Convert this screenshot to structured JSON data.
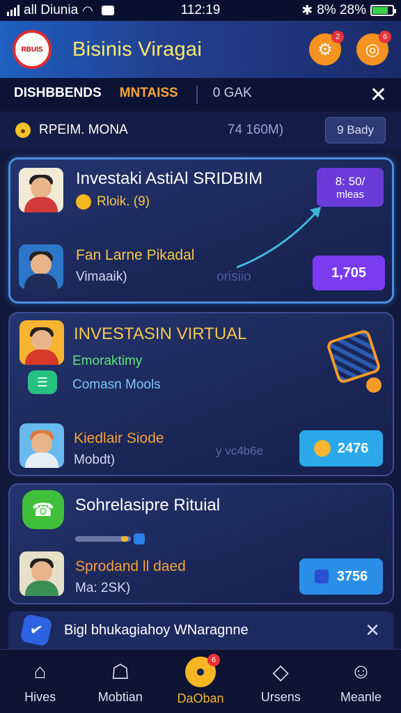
{
  "status_bar": {
    "carrier": "all Diunia",
    "time": "112:19",
    "battery_text": "8% 28%",
    "battery_level": 0.8
  },
  "header": {
    "logo_text": "RBUIS",
    "title": "Bisinis Viragai",
    "settings_badge": "2",
    "profile_badge": "6"
  },
  "tabs": [
    {
      "label": "DISHBBENDS"
    },
    {
      "label": "MNTAISS"
    },
    {
      "label": "0 GAK"
    }
  ],
  "filter": {
    "label": "RPEIM. MONA",
    "value": "74 160M)",
    "button": "9 Bady"
  },
  "cards": [
    {
      "title": "Investaki AstiAl SRIDBIM",
      "sub": "Rloik. (9)",
      "badge_top": "8: 50/",
      "badge_sub": "mleas",
      "person_name": "Fan Larne Pikadal",
      "person_sub": "Vimaaik)",
      "watermark": "orisiio",
      "price": "1,705"
    },
    {
      "title": "INVESTASIN VIRTUAL",
      "sub_green": "Emoraktimy",
      "sub_blue": "Comasn Mools",
      "person_name": "Kiedlair Siode",
      "person_sub": "Mobdt)",
      "watermark": "y vc4b6e",
      "price": "2476"
    },
    {
      "title": "Sohrelasipre Rituial",
      "person_name": "Sprodand ll daed",
      "person_sub": "Ma: 2SK)",
      "price": "3756"
    }
  ],
  "banner": {
    "text": "Bigl bhukagiahoy WNaragnne"
  },
  "nav": [
    {
      "label": "Hives",
      "icon": "home-icon"
    },
    {
      "label": "Mobtian",
      "icon": "bag-icon"
    },
    {
      "label": "DaOban",
      "icon": "chat-icon",
      "badge": "6"
    },
    {
      "label": "Ursens",
      "icon": "diamond-icon"
    },
    {
      "label": "Meanle",
      "icon": "user-icon"
    }
  ]
}
